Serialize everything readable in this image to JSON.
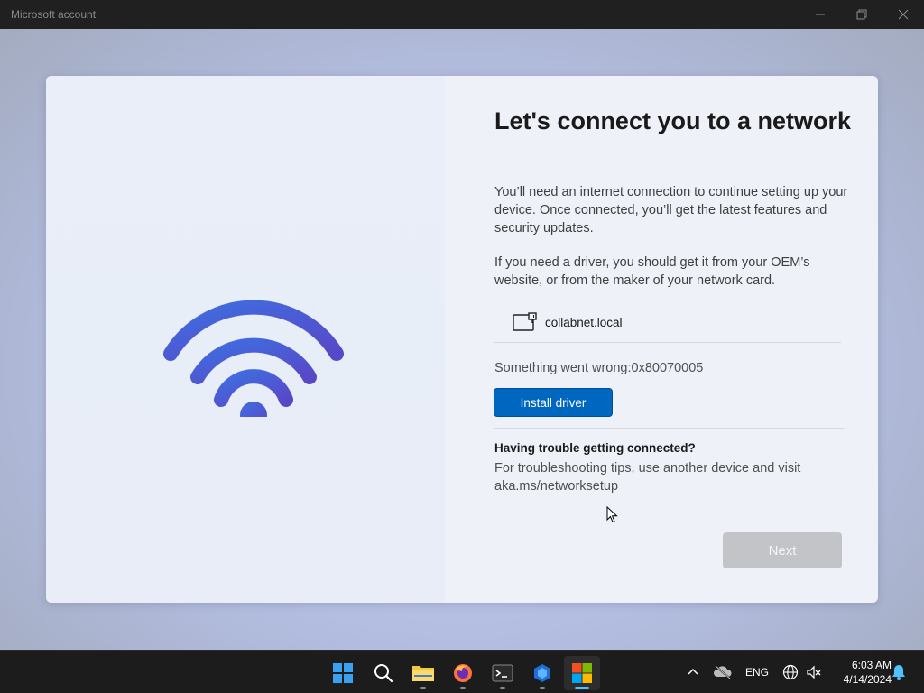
{
  "window": {
    "title": "Microsoft account"
  },
  "page": {
    "heading": "Let's connect you to a network",
    "paragraph1": "You’ll need an internet connection to continue setting up your device. Once connected, you’ll get the latest features and security updates.",
    "paragraph2": "If you need a driver, you should get it from your OEM’s website, or from the maker of your network card.",
    "network": {
      "icon": "ethernet-icon",
      "name": "collabnet.local"
    },
    "error": "Something went wrong:0x80070005",
    "install_driver_label": "Install driver",
    "trouble_title": "Having trouble getting connected?",
    "trouble_text": "For troubleshooting tips, use another device and visit aka.ms/networksetup",
    "next_label": "Next"
  },
  "taskbar": {
    "apps": [
      {
        "name": "start-icon"
      },
      {
        "name": "search-icon"
      },
      {
        "name": "file-explorer-icon"
      },
      {
        "name": "firefox-icon"
      },
      {
        "name": "terminal-icon"
      },
      {
        "name": "app-icon"
      },
      {
        "name": "microsoft-store-icon"
      }
    ],
    "tray": {
      "language": "ENG",
      "time": "6:03 AM",
      "date": "4/14/2024"
    }
  },
  "colors": {
    "accent": "#0067c0",
    "wifi_gradient_start": "#3f6ee0",
    "wifi_gradient_end": "#5848c8"
  }
}
